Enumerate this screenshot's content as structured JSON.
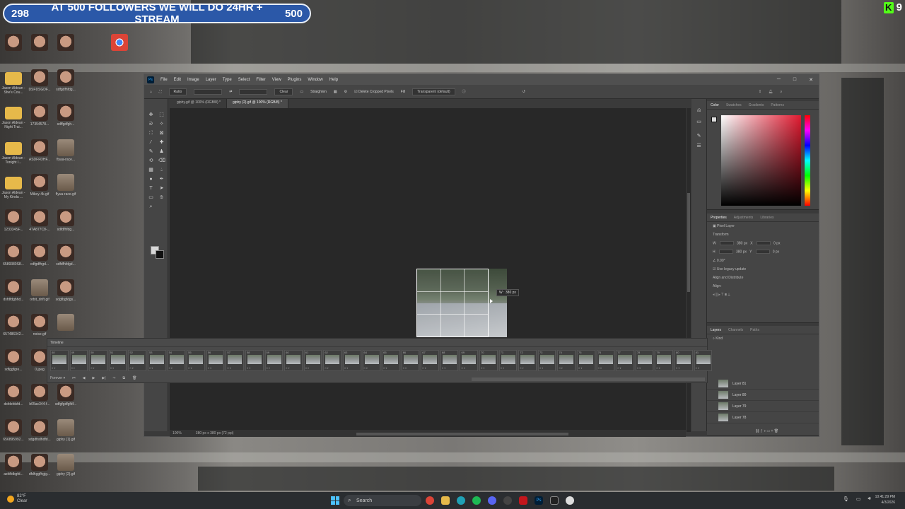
{
  "stream_banner": {
    "left_count": "298",
    "message": "AT 500 FOLLOWERS WE WILL DO 24HR + STREAM",
    "goal": "500"
  },
  "kick_badge": {
    "letter": "K",
    "viewers": "9"
  },
  "desktop_icons": [
    {
      "label": "",
      "kind": "face"
    },
    {
      "label": "",
      "kind": "face"
    },
    {
      "label": "",
      "kind": "face"
    },
    {
      "label": "",
      "kind": "chrome"
    },
    {
      "label": "Jason Aldean - She's Cou...",
      "kind": "folder"
    },
    {
      "label": "DSFDSGDF...",
      "kind": "face"
    },
    {
      "label": "sdfgdfhfdg...",
      "kind": "face"
    },
    {
      "label": "Jason Aldean - Night Trai...",
      "kind": "folder"
    },
    {
      "label": "17354578...",
      "kind": "face"
    },
    {
      "label": "sdffgdfgh...",
      "kind": "face"
    },
    {
      "label": "Jason Aldean - Tonight I...",
      "kind": "folder"
    },
    {
      "label": "ASDFFDHF...",
      "kind": "face"
    },
    {
      "label": "flyaa-race...",
      "kind": "gif"
    },
    {
      "label": "Jason Aldean - My Kinda ...",
      "kind": "folder"
    },
    {
      "label": "Mikey-4k.gif",
      "kind": "face"
    },
    {
      "label": "flyuu-race.gif",
      "kind": "gif"
    },
    {
      "label": "123334SF...",
      "kind": "face"
    },
    {
      "label": "47A877C8-...",
      "kind": "face"
    },
    {
      "label": "sdfdfhfdg...",
      "kind": "face"
    },
    {
      "label": "6589380S8...",
      "kind": "face"
    },
    {
      "label": "cdfgdfhgd...",
      "kind": "face"
    },
    {
      "label": "sdfdfhfdgd...",
      "kind": "face"
    },
    {
      "label": "dsfdfdgbhd...",
      "kind": "face"
    },
    {
      "label": "orbit_drift.gif",
      "kind": "gif"
    },
    {
      "label": "sdgfbgfdgs...",
      "kind": "face"
    },
    {
      "label": "657486342...",
      "kind": "face"
    },
    {
      "label": "noise.gif",
      "kind": "face"
    },
    {
      "label": "",
      "kind": "gif"
    },
    {
      "label": "sdfggfgre...",
      "kind": "face"
    },
    {
      "label": "0.jpeg",
      "kind": "face"
    },
    {
      "label": "",
      "kind": "gif"
    },
    {
      "label": "dsfdsfdsfd...",
      "kind": "face"
    },
    {
      "label": "b05ac344-f...",
      "kind": "face"
    },
    {
      "label": "sdfgfgdfgfdf...",
      "kind": "face"
    },
    {
      "label": "656895992...",
      "kind": "face"
    },
    {
      "label": "sdgdfsdhdfd...",
      "kind": "face"
    },
    {
      "label": "giphy (1).gif",
      "kind": "gif"
    },
    {
      "label": "asfdfdbgfd...",
      "kind": "face"
    },
    {
      "label": "dfdhggfhgjg...",
      "kind": "face"
    },
    {
      "label": "giphy (2).gif",
      "kind": "gif"
    }
  ],
  "photoshop": {
    "menu": [
      "File",
      "Edit",
      "Image",
      "Layer",
      "Type",
      "Select",
      "Filter",
      "View",
      "Plugins",
      "Window",
      "Help"
    ],
    "options": {
      "ratio": "Ratio",
      "clear": "Clear",
      "straighten": "Straighten",
      "delete_cropped": "Delete Cropped Pixels",
      "fill": "Fill",
      "fill_value": "Transparent (default)"
    },
    "tabs": [
      "giphy.gif @ 100% (RGB/8) *",
      "giphy (2).gif @ 100% (RGB/8) *"
    ],
    "crop_tooltip": "W : 380 px",
    "status": {
      "zoom": "100%",
      "doc": "380 px x 380 px (72 ppi)"
    },
    "color_tabs": [
      "Color",
      "Swatches",
      "Gradients",
      "Patterns"
    ],
    "props_tabs": [
      "Properties",
      "Adjustments",
      "Libraries"
    ],
    "props": {
      "kind": "Pixel Layer",
      "transform": "Transform",
      "w": "380 px",
      "h": "380 px",
      "x": "0 px",
      "y": "0 px",
      "angle": "0.00°",
      "use_legacy": "Use legacy update",
      "align": "Align and Distribute",
      "align_sub": "Align:"
    },
    "layers_tabs": [
      "Layers",
      "Channels",
      "Paths"
    ],
    "layers_kind": "Kind",
    "layers": [
      "Layer 81",
      "Layer 80",
      "Layer 79",
      "Layer 78"
    ],
    "timeline_title": "Timeline",
    "timeline_start": 48,
    "frame_delay": "0 ▾",
    "loop": "Forever ▾"
  },
  "taskbar": {
    "temp": "82°F",
    "weather": "Clear",
    "search": "Search",
    "time": "10:41:29 PM",
    "date": "4/3/2026"
  }
}
